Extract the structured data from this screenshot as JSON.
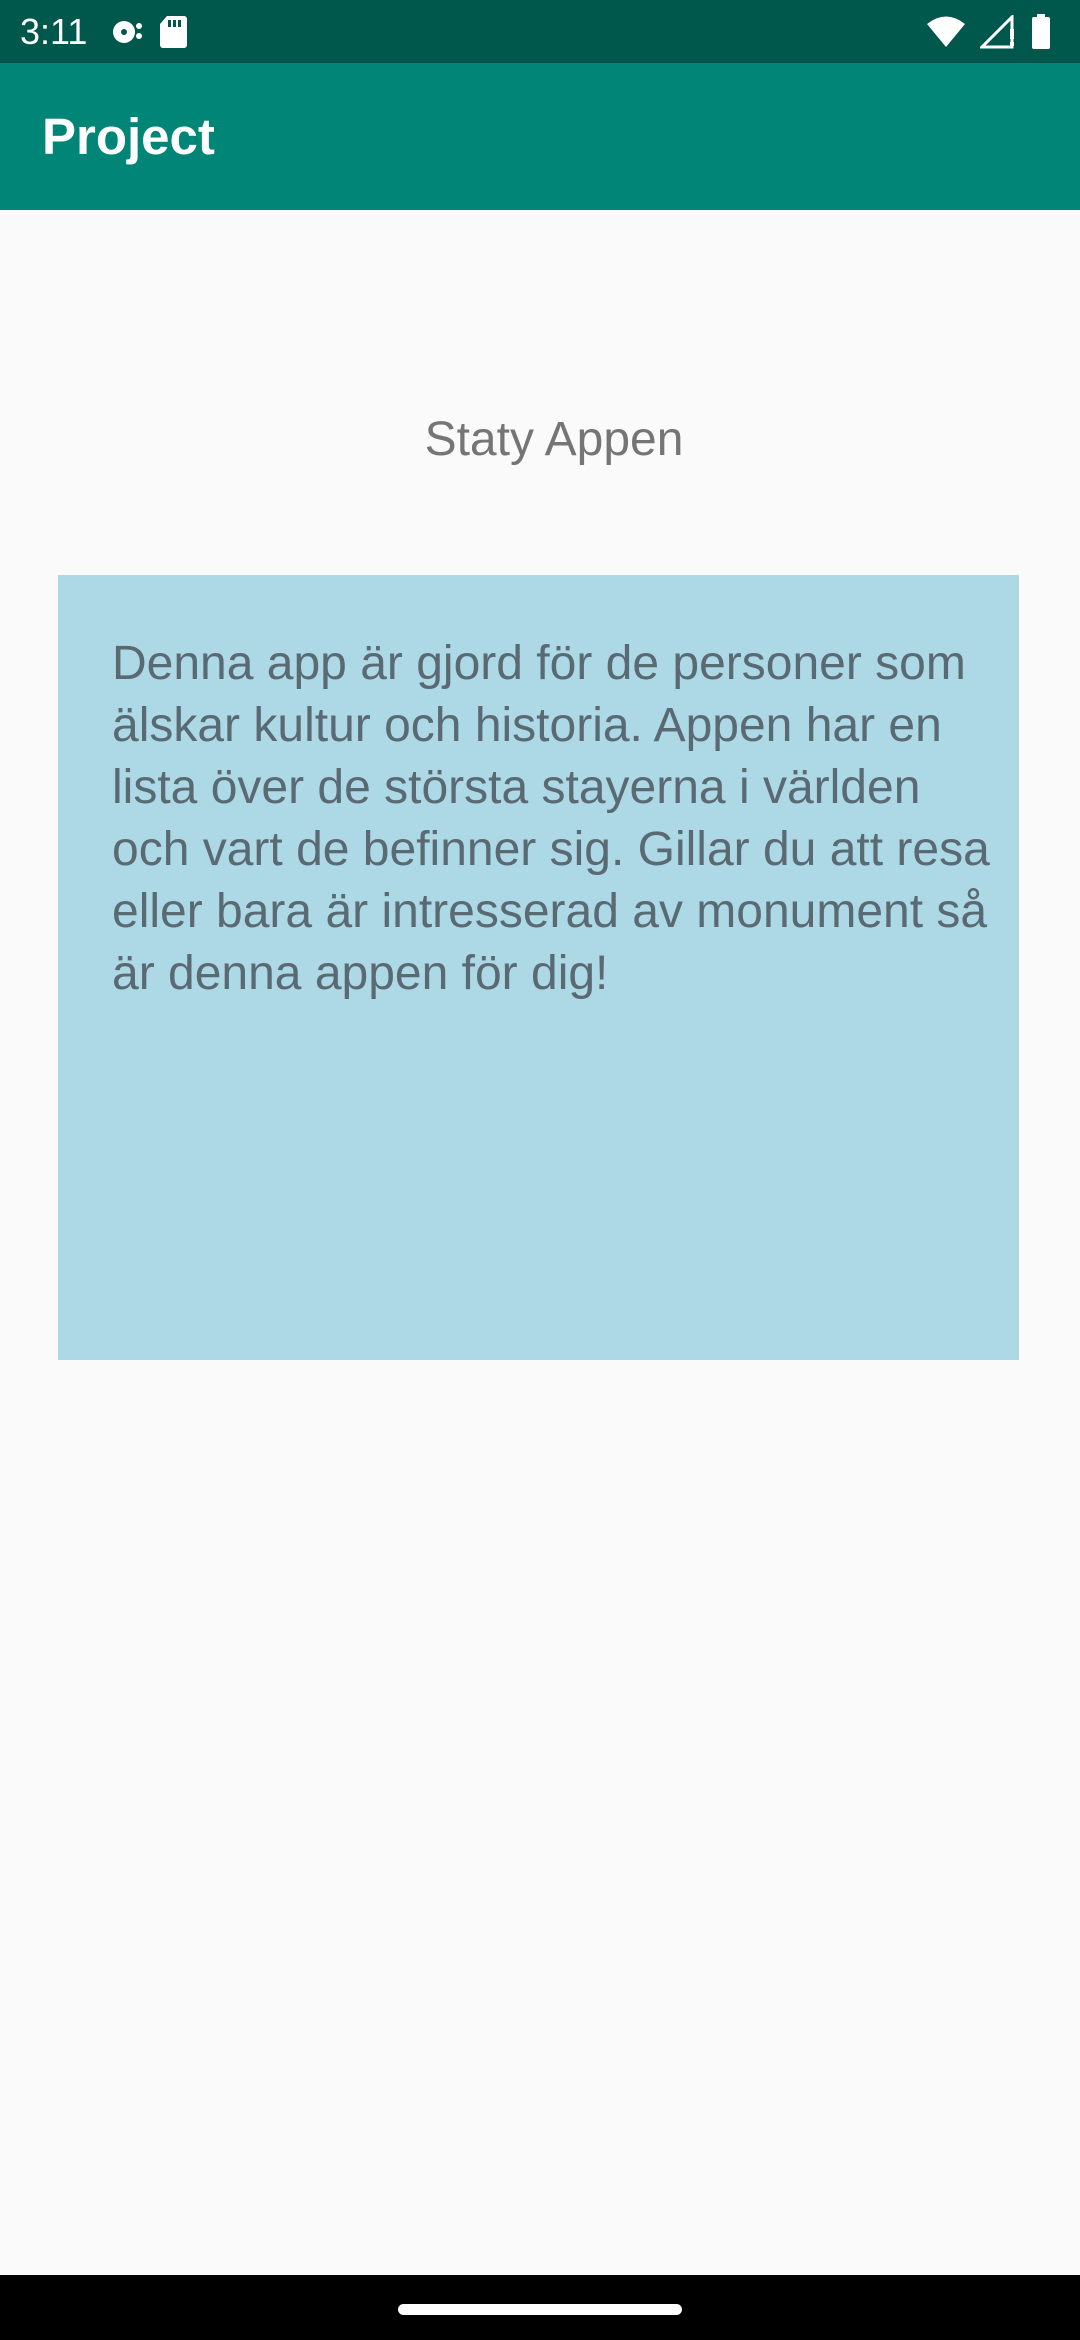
{
  "status_bar": {
    "time": "3:11",
    "left_icons": [
      "media-icon",
      "sd-card-icon"
    ],
    "right_icons": [
      "wifi-icon",
      "signal-icon",
      "battery-icon"
    ]
  },
  "app_bar": {
    "title": "Project",
    "color": "#008577"
  },
  "main": {
    "heading": "Staty Appen",
    "description": "Denna app är gjord för de personer som älskar kultur och historia. Appen har en lista över de största stayerna i världen och vart de befinner sig. Gillar du att resa eller bara är intresserad av monument så är denna appen för dig!",
    "box_color": "#add8e6"
  },
  "nav_bar": {
    "handle": "home-handle"
  }
}
